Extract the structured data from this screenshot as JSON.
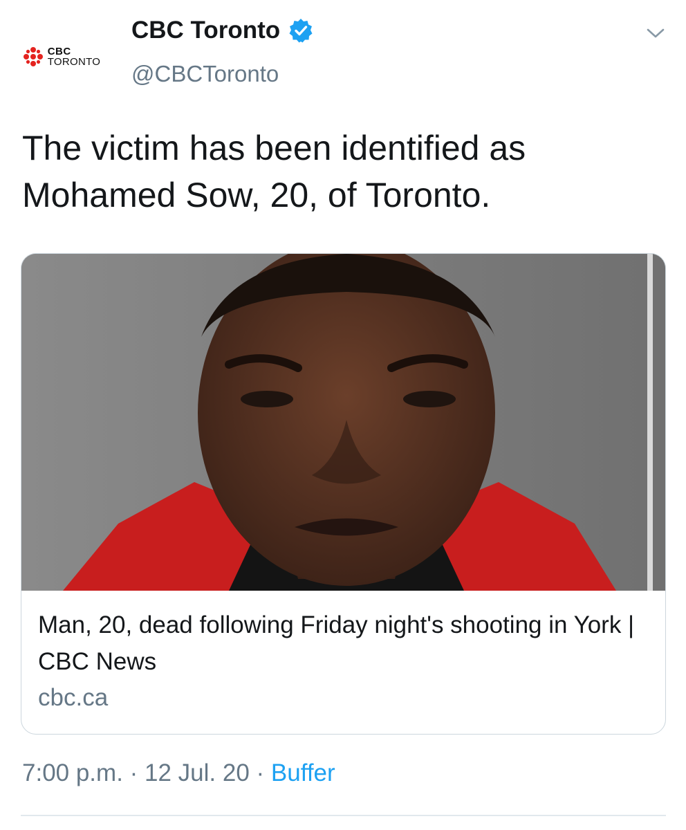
{
  "account": {
    "display_name": "CBC Toronto",
    "handle": "@CBCToronto",
    "logo_line1": "CBC",
    "logo_line2": "TORONTO",
    "verified": true
  },
  "icons": {
    "avatar": "cbc-gem-logo",
    "verified": "verified-badge-icon",
    "menu": "chevron-down-icon"
  },
  "tweet": {
    "text": "The victim has been identified as Mohamed Sow, 20, of Toronto."
  },
  "card": {
    "image_description_icon": "photo",
    "title": "Man, 20, dead following Friday night's shooting in York | CBC News",
    "domain": "cbc.ca"
  },
  "meta": {
    "time": "7:00 p.m.",
    "separator": " · ",
    "date": "12 Jul. 20",
    "source": "Buffer"
  },
  "colors": {
    "brand_red": "#e4231f",
    "verified_blue": "#1da1f2",
    "secondary_text": "#657786",
    "link_blue": "#1da1f2"
  }
}
